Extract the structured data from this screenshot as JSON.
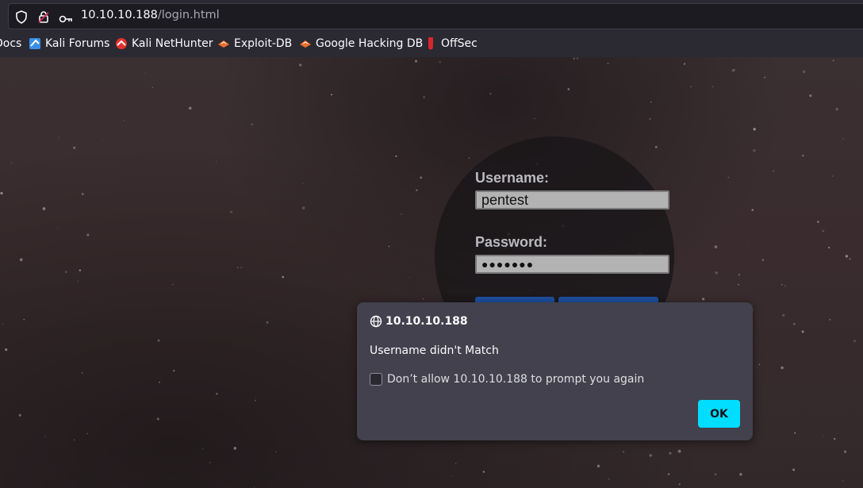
{
  "browser": {
    "url_host": "10.10.10.188",
    "url_path": "/login.html",
    "bookmarks": [
      {
        "label": "Docs",
        "icon": "docs-icon"
      },
      {
        "label": "Kali Forums",
        "icon": "kali-forums-icon"
      },
      {
        "label": "Kali NetHunter",
        "icon": "kali-nethunter-icon"
      },
      {
        "label": "Exploit-DB",
        "icon": "exploit-db-icon"
      },
      {
        "label": "Google Hacking DB",
        "icon": "google-hacking-db-icon"
      },
      {
        "label": "OffSec",
        "icon": "offsec-icon"
      }
    ]
  },
  "login": {
    "username_label": "Username:",
    "username_value": "pentest",
    "password_label": "Password:",
    "password_value": "●●●●●●●"
  },
  "dialog": {
    "origin": "10.10.10.188",
    "message": "Username didn't Match",
    "checkbox_label": "Don’t allow 10.10.10.188 to prompt you again",
    "ok_label": "OK"
  },
  "colors": {
    "accent": "#00ddff",
    "login_button": "#1d4f9e"
  }
}
